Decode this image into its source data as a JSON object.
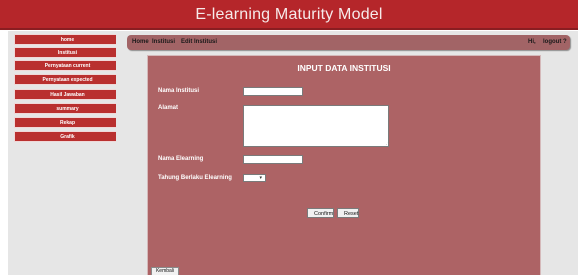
{
  "app": {
    "title": "E-learning Maturity Model"
  },
  "sidebar": {
    "items": [
      {
        "label": "home"
      },
      {
        "label": "Institusi"
      },
      {
        "label": "Pernyataan current"
      },
      {
        "label": "Pernyataan expected"
      },
      {
        "label": "Hasil Jawaban"
      },
      {
        "label": "summary"
      },
      {
        "label": "Rekap"
      },
      {
        "label": "Grafik"
      }
    ]
  },
  "breadcrumb": {
    "home": "Home",
    "institusi": "Institusi",
    "edit": "Edit Institusi"
  },
  "user": {
    "greeting": "Hi,",
    "logout": "logout ?"
  },
  "form": {
    "title": "INPUT DATA INSTITUSI",
    "fields": {
      "nama_institusi": {
        "label": "Nama Institusi",
        "value": ""
      },
      "alamat": {
        "label": "Alamat",
        "value": ""
      },
      "nama_elearning": {
        "label": "Nama Elearning",
        "value": ""
      },
      "tahun_berlaku": {
        "label": "Tahung Berlaku Elearning",
        "value": ""
      }
    },
    "confirm_label": "Confirm",
    "reset_label": "Reset",
    "kembali_label": "Kembali"
  },
  "colors": {
    "header": "#b5262a",
    "sidebar_item": "#b9302f",
    "panel": "#ad6365",
    "topbar": "#a26466",
    "page_bg": "#e6e6e6"
  }
}
